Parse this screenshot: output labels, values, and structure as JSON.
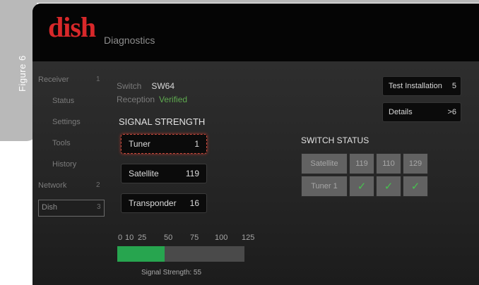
{
  "figure_label": "Figure 6",
  "header": {
    "logo": "dish",
    "title": "Diagnostics"
  },
  "nav": {
    "items": [
      {
        "label": "Receiver",
        "number": "1",
        "level": "top"
      },
      {
        "label": "Status",
        "number": "",
        "level": "sub"
      },
      {
        "label": "Settings",
        "number": "",
        "level": "sub"
      },
      {
        "label": "Tools",
        "number": "",
        "level": "sub"
      },
      {
        "label": "History",
        "number": "",
        "level": "sub"
      },
      {
        "label": "Network",
        "number": "2",
        "level": "top"
      },
      {
        "label": "Dish",
        "number": "3",
        "level": "top",
        "selected": true
      }
    ]
  },
  "info": {
    "switch_label": "Switch",
    "switch_value": "SW64",
    "reception_label": "Reception",
    "reception_value": "Verified"
  },
  "signal": {
    "title": "SIGNAL STRENGTH",
    "tuner_label": "Tuner",
    "tuner_value": "1",
    "satellite_label": "Satellite",
    "satellite_value": "119",
    "transponder_label": "Transponder",
    "transponder_value": "16",
    "scale_ticks": [
      "0",
      "10",
      "25",
      "50",
      "75",
      "100",
      "125"
    ],
    "strength_value": 55,
    "strength_max": 125,
    "caption": "Signal Strength: 55"
  },
  "actions": {
    "test_installation_label": "Test Installation",
    "test_installation_num": "5",
    "details_label": "Details",
    "details_num": ">6"
  },
  "switch_status": {
    "title": "SWITCH STATUS",
    "row1": [
      "Satellite",
      "119",
      "110",
      "129"
    ],
    "row2_label": "Tuner 1",
    "check_glyph": "✓"
  },
  "colors": {
    "brand_red": "#d8282a",
    "verified_green": "#5ea94f",
    "bar_green": "#27a54f",
    "check_green": "#47c14f"
  }
}
